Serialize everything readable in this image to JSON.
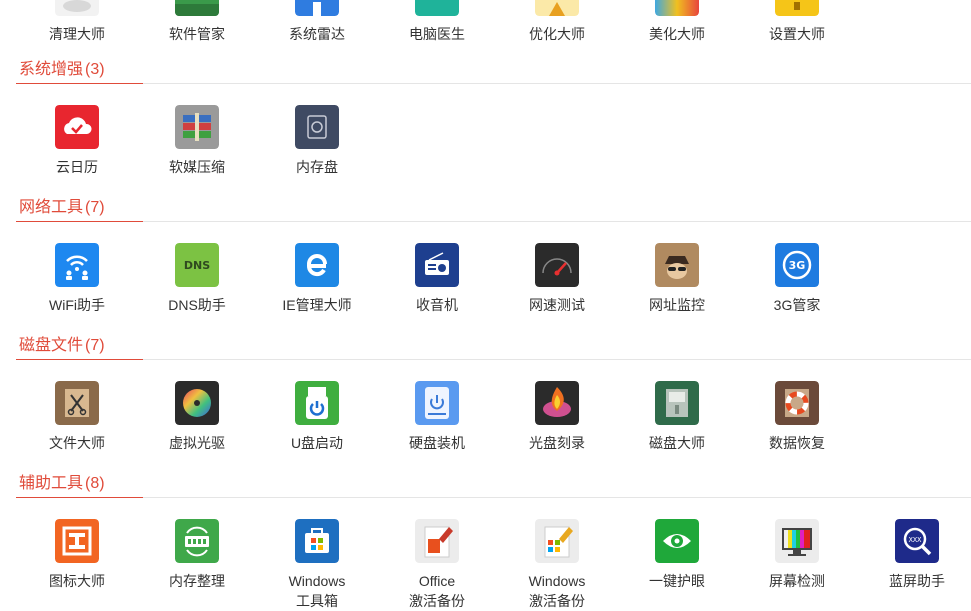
{
  "top_row": [
    {
      "label": "清理大师",
      "icon": "broom-icon",
      "color": "#f0f0f0"
    },
    {
      "label": "软件管家",
      "icon": "software-manager-icon",
      "color": "#2f8f3f"
    },
    {
      "label": "系统雷达",
      "icon": "radar-icon",
      "color": "#2f7ce0"
    },
    {
      "label": "电脑医生",
      "icon": "doctor-icon",
      "color": "#1fb39a"
    },
    {
      "label": "优化大师",
      "icon": "optimize-icon",
      "color": "#f7c948"
    },
    {
      "label": "美化大师",
      "icon": "beautify-icon",
      "color": "#e8453c"
    },
    {
      "label": "设置大师",
      "icon": "settings-icon",
      "color": "#f0b400"
    }
  ],
  "sections": [
    {
      "title": "系统增强",
      "count": "(3)",
      "items": [
        {
          "label": "云日历",
          "icon": "cloud-calendar-icon",
          "color": "#e8262f"
        },
        {
          "label": "软媒压缩",
          "icon": "archive-books-icon",
          "color": "#8a8a8a"
        },
        {
          "label": "内存盘",
          "icon": "memory-disk-icon",
          "color": "#3f4a63"
        }
      ]
    },
    {
      "title": "网络工具",
      "count": "(7)",
      "items": [
        {
          "label": "WiFi助手",
          "icon": "wifi-icon",
          "color": "#1e88f0"
        },
        {
          "label": "DNS助手",
          "icon": "dns-icon",
          "color": "#7cc243"
        },
        {
          "label": "IE管理大师",
          "icon": "ie-icon",
          "color": "#1e88e5"
        },
        {
          "label": "收音机",
          "icon": "radio-icon",
          "color": "#1e3f8f"
        },
        {
          "label": "网速测试",
          "icon": "speedometer-icon",
          "color": "#2b2b2b"
        },
        {
          "label": "网址监控",
          "icon": "spy-icon",
          "color": "#a07850"
        },
        {
          "label": "3G管家",
          "icon": "3g-icon",
          "color": "#1e7be0"
        }
      ]
    },
    {
      "title": "磁盘文件",
      "count": "(7)",
      "items": [
        {
          "label": "文件大师",
          "icon": "scissors-box-icon",
          "color": "#8a6a4a"
        },
        {
          "label": "虚拟光驱",
          "icon": "virtual-disc-icon",
          "color": "#2b2b2b"
        },
        {
          "label": "U盘启动",
          "icon": "usb-boot-icon",
          "color": "#3fae3f"
        },
        {
          "label": "硬盘装机",
          "icon": "hard-disk-icon",
          "color": "#4a8fe8"
        },
        {
          "label": "光盘刻录",
          "icon": "disc-burn-icon",
          "color": "#2b2b2b"
        },
        {
          "label": "磁盘大师",
          "icon": "disk-master-icon",
          "color": "#2f6b4a"
        },
        {
          "label": "数据恢复",
          "icon": "lifebuoy-icon",
          "color": "#6b4a3a"
        }
      ]
    },
    {
      "title": "辅助工具",
      "count": "(8)",
      "items": [
        {
          "label": "图标大师",
          "icon": "icon-master-icon",
          "color": "#f26522"
        },
        {
          "label": "内存整理",
          "icon": "memory-clean-icon",
          "color": "#3fa84a"
        },
        {
          "label": "Windows\n工具箱",
          "icon": "windows-toolbox-icon",
          "color": "#1e6fc0"
        },
        {
          "label": "Office\n激活备份",
          "icon": "office-backup-icon",
          "color": "#e8e8e8"
        },
        {
          "label": "Windows\n激活备份",
          "icon": "windows-backup-icon",
          "color": "#e8e8e8"
        },
        {
          "label": "一键护眼",
          "icon": "eye-care-icon",
          "color": "#1fa83a"
        },
        {
          "label": "屏幕检测",
          "icon": "screen-test-icon",
          "color": "#e8e8e8"
        },
        {
          "label": "蓝屏助手",
          "icon": "bluescreen-icon",
          "color": "#1e2a8a"
        }
      ]
    }
  ],
  "labels_two_line": {
    "windows_toolbox": [
      "Windows",
      "工具箱"
    ],
    "office_backup": [
      "Office",
      "激活备份"
    ],
    "windows_backup": [
      "Windows",
      "激活备份"
    ]
  }
}
